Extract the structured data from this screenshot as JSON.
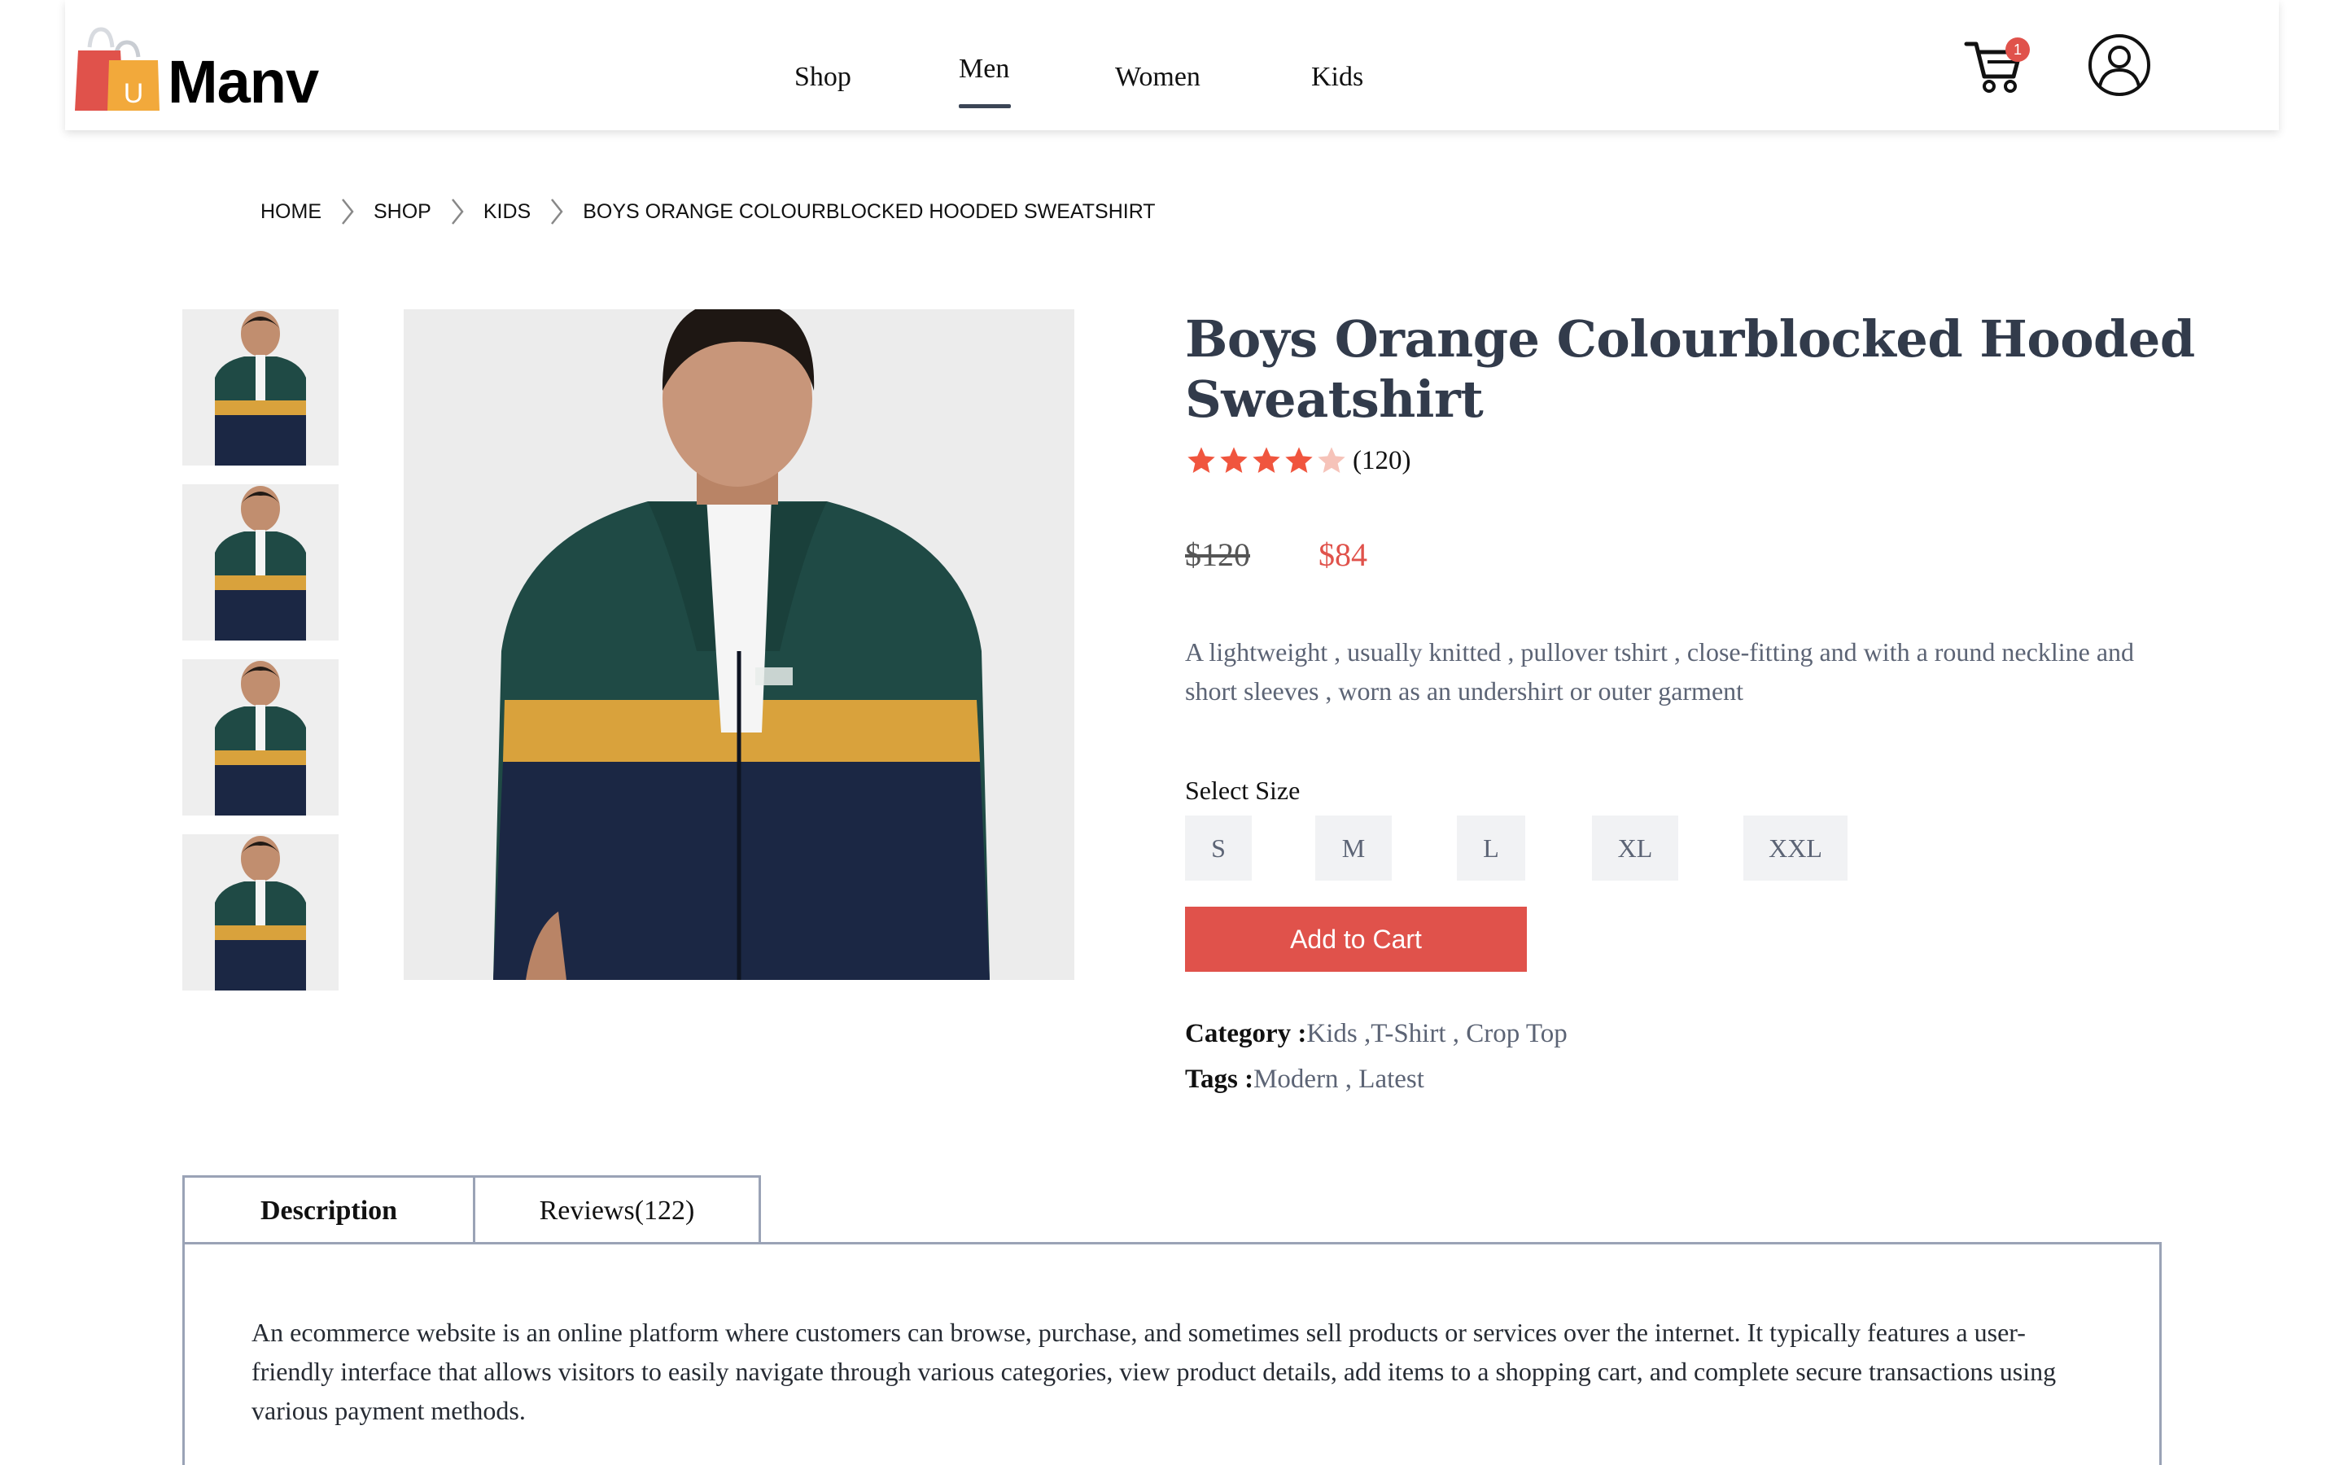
{
  "brand": {
    "name": "Manv",
    "bag_letter": "U"
  },
  "nav": {
    "items": [
      {
        "label": "Shop"
      },
      {
        "label": "Men"
      },
      {
        "label": "Women"
      },
      {
        "label": "Kids"
      }
    ],
    "active": "Men"
  },
  "cart": {
    "count": "1",
    "icon": "cart-icon"
  },
  "user": {
    "icon": "user-icon"
  },
  "breadcrumb": [
    "HOME",
    "SHOP",
    "KIDS",
    "BOYS ORANGE COLOURBLOCKED HOODED SWEATSHIRT"
  ],
  "product": {
    "title": "Boys Orange Colourblocked Hooded Sweatshirt",
    "rating": 4,
    "rating_max": 5,
    "rating_count": "(120)",
    "price_old": "$120",
    "price_new": "$84",
    "description": "A lightweight , usually knitted , pullover tshirt , close-fitting and with a round neckline and short sleeves , worn as an undershirt or outer garment",
    "select_size_label": "Select Size",
    "sizes": [
      "S",
      "M",
      "L",
      "XL",
      "XXL"
    ],
    "add_to_cart_label": "Add to Cart",
    "category_label": "Category :",
    "category_value": "Kids ,T-Shirt , Crop Top",
    "tags_label": "Tags :",
    "tags_value": "Modern , Latest"
  },
  "tabs": {
    "items": [
      "Description",
      "Reviews(122)"
    ],
    "active": "Description",
    "description_text": "An ecommerce website is an online platform where customers can browse, purchase, and sometimes sell products or services over the internet. It typically features a user-friendly interface that allows visitors to easily navigate through various categories, view product details, add items to a shopping cart, and complete secure transactions using various payment methods."
  },
  "colors": {
    "accent": "#e0524b",
    "title": "#323b4b",
    "muted": "#5c6475",
    "star_filled": "#f0553e",
    "star_empty": "#f6c3b9",
    "jacket_green": "#1f4a45",
    "jacket_navy": "#1b2744",
    "jacket_stripe": "#d9a23c"
  }
}
